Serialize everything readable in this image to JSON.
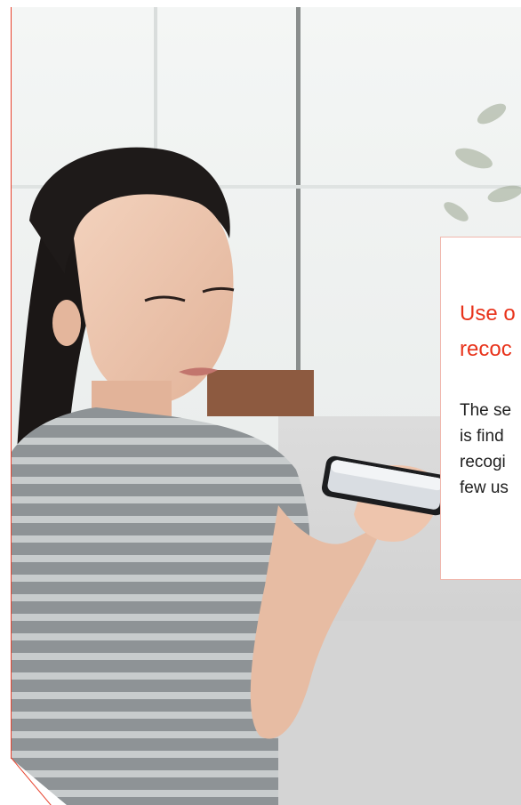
{
  "card": {
    "title": "Use o\nrecoc",
    "body": "The se\nis find\nrecogi\nfew us"
  },
  "colors": {
    "accent": "#e8331b",
    "card_border": "#f0b7ad",
    "body_text": "#1f1f1f"
  },
  "hero": {
    "image": "woman-speaking-into-smartphone-photo"
  }
}
